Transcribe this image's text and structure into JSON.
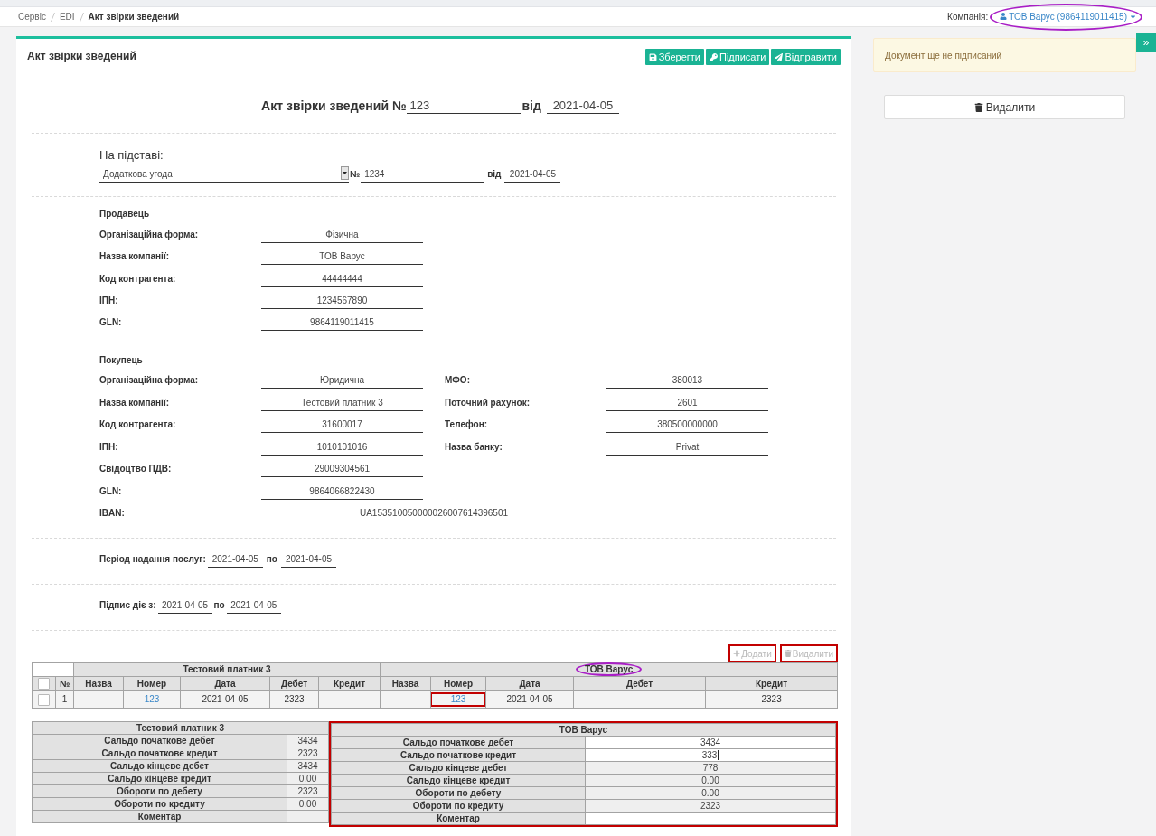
{
  "breadcrumbs": [
    {
      "label": "Сервіс",
      "current": false
    },
    {
      "label": "EDI",
      "current": false
    },
    {
      "label": "Акт звірки зведений",
      "current": true
    }
  ],
  "company": {
    "label": "Компанія:",
    "value": "ТОВ Варус (9864119011415)",
    "circled": true
  },
  "document": {
    "title": "Акт звірки зведений",
    "actions": [
      {
        "label": "Зберегти",
        "kind": "save"
      },
      {
        "label": "Підписати",
        "kind": "sign"
      },
      {
        "label": "Відправити",
        "kind": "send"
      }
    ]
  },
  "heading": {
    "title": "Акт звірки зведений №",
    "number": "123",
    "date_label": "від",
    "date": "2021-04-05"
  },
  "basis": {
    "title": "На підставі:",
    "type": "Додаткова угода",
    "number_label": "№",
    "number": "1234",
    "date_label": "від",
    "date": "2021-04-05"
  },
  "seller": {
    "title": "Продавець",
    "fields": [
      {
        "label": "Організаційна форма:",
        "value": "Фізична"
      },
      {
        "label": "Назва компанії:",
        "value": "ТОВ Варус"
      },
      {
        "label": "Код контрагента:",
        "value": "44444444"
      },
      {
        "label": "ІПН:",
        "value": "1234567890"
      },
      {
        "label": "GLN:",
        "value": "9864119011415"
      }
    ]
  },
  "buyer": {
    "title": "Покупець",
    "fields": [
      {
        "label": "Організаційна форма:",
        "value": "Юридична"
      },
      {
        "label": "Назва компанії:",
        "value": "Тестовий платник 3"
      },
      {
        "label": "Код контрагента:",
        "value": "31600017"
      },
      {
        "label": "ІПН:",
        "value": "1010101016"
      },
      {
        "label": "Свідоцтво ПДВ:",
        "value": "29009304561"
      },
      {
        "label": "GLN:",
        "value": "9864066822430"
      }
    ],
    "bank_fields": [
      {
        "label": "МФО:",
        "value": "380013"
      },
      {
        "label": "Поточний рахунок:",
        "value": "2601"
      },
      {
        "label": "Телефон:",
        "value": "380500000000"
      },
      {
        "label": "Назва банку:",
        "value": "Privat"
      }
    ],
    "iban": {
      "label": "IBAN:",
      "value": "UA153510050000026007614396501"
    }
  },
  "service_period": {
    "label": "Період надання послуг:",
    "from": "2021-04-05",
    "separator": "по",
    "to": "2021-04-05"
  },
  "signature_period": {
    "label": "Підпис діє з:",
    "from": "2021-04-05",
    "separator": "по",
    "to": "2021-04-05"
  },
  "table_actions": [
    {
      "label": "Додати",
      "kind": "add",
      "disabled": true,
      "boxed": true
    },
    {
      "label": "Видалити",
      "kind": "delete",
      "disabled": true,
      "boxed": true
    }
  ],
  "documents_table": {
    "select_all": {
      "checked": false
    },
    "number_header": "№",
    "groups": [
      {
        "title": "Тестовий платник 3",
        "circled": false,
        "columns": [
          {
            "label": "Назва",
            "kind": "name"
          },
          {
            "label": "Номер",
            "kind": "number"
          },
          {
            "label": "Дата",
            "kind": "date"
          },
          {
            "label": "Дебет",
            "kind": "debit"
          },
          {
            "label": "Кредит",
            "kind": "credit"
          }
        ]
      },
      {
        "title": "ТОВ Варус",
        "circled": true,
        "columns": [
          {
            "label": "Назва",
            "kind": "name"
          },
          {
            "label": "Номер",
            "kind": "number"
          },
          {
            "label": "Дата",
            "kind": "date"
          },
          {
            "label": "Дебет",
            "kind": "debit"
          },
          {
            "label": "Кредит",
            "kind": "credit"
          }
        ]
      }
    ],
    "rows": [
      {
        "checked": false,
        "number": "1",
        "sides": [
          {
            "number": {
              "text": "123",
              "boxed": false
            },
            "date": {
              "text": "2021-04-05",
              "boxed": false
            },
            "debit": {
              "text": "2323",
              "boxed": false
            }
          },
          {
            "number": {
              "text": "123",
              "boxed": true
            },
            "date": {
              "text": "2021-04-05",
              "boxed": false
            },
            "credit": {
              "text": "2323",
              "boxed": false
            }
          }
        ]
      }
    ]
  },
  "summary": [
    {
      "title": "Тестовий платник 3",
      "boxed": false,
      "rows": [
        {
          "label": "Сальдо початкове дебет",
          "value": "3434",
          "editable": false,
          "focused": false
        },
        {
          "label": "Сальдо початкове кредит",
          "value": "2323",
          "editable": false,
          "focused": false
        },
        {
          "label": "Сальдо кінцеве дебет",
          "value": "3434",
          "editable": false,
          "focused": false
        },
        {
          "label": "Сальдо кінцеве кредит",
          "value": "0.00",
          "editable": false,
          "focused": false
        },
        {
          "label": "Обороти по дебету",
          "value": "2323",
          "editable": false,
          "focused": false
        },
        {
          "label": "Обороти по кредиту",
          "value": "0.00",
          "editable": false,
          "focused": false
        },
        {
          "label": "Коментар",
          "editable": false,
          "focused": false
        }
      ]
    },
    {
      "title": "ТОВ Варус",
      "boxed": true,
      "rows": [
        {
          "label": "Сальдо початкове дебет",
          "value": "3434",
          "editable": true,
          "focused": false
        },
        {
          "label": "Сальдо початкове кредит",
          "value": "333",
          "editable": true,
          "focused": true
        },
        {
          "label": "Сальдо кінцеве дебет",
          "value": "778",
          "editable": false,
          "focused": false
        },
        {
          "label": "Сальдо кінцеве кредит",
          "value": "0.00",
          "editable": false,
          "focused": false
        },
        {
          "label": "Обороти по дебету",
          "value": "0.00",
          "editable": false,
          "focused": false
        },
        {
          "label": "Обороти по кредиту",
          "value": "2323",
          "editable": false,
          "focused": false
        },
        {
          "label": "Коментар",
          "editable": true,
          "focused": false
        }
      ]
    }
  ],
  "sidebar": {
    "toggle": "»",
    "status": "Документ ще не підписаний",
    "delete_button": "Видалити"
  }
}
